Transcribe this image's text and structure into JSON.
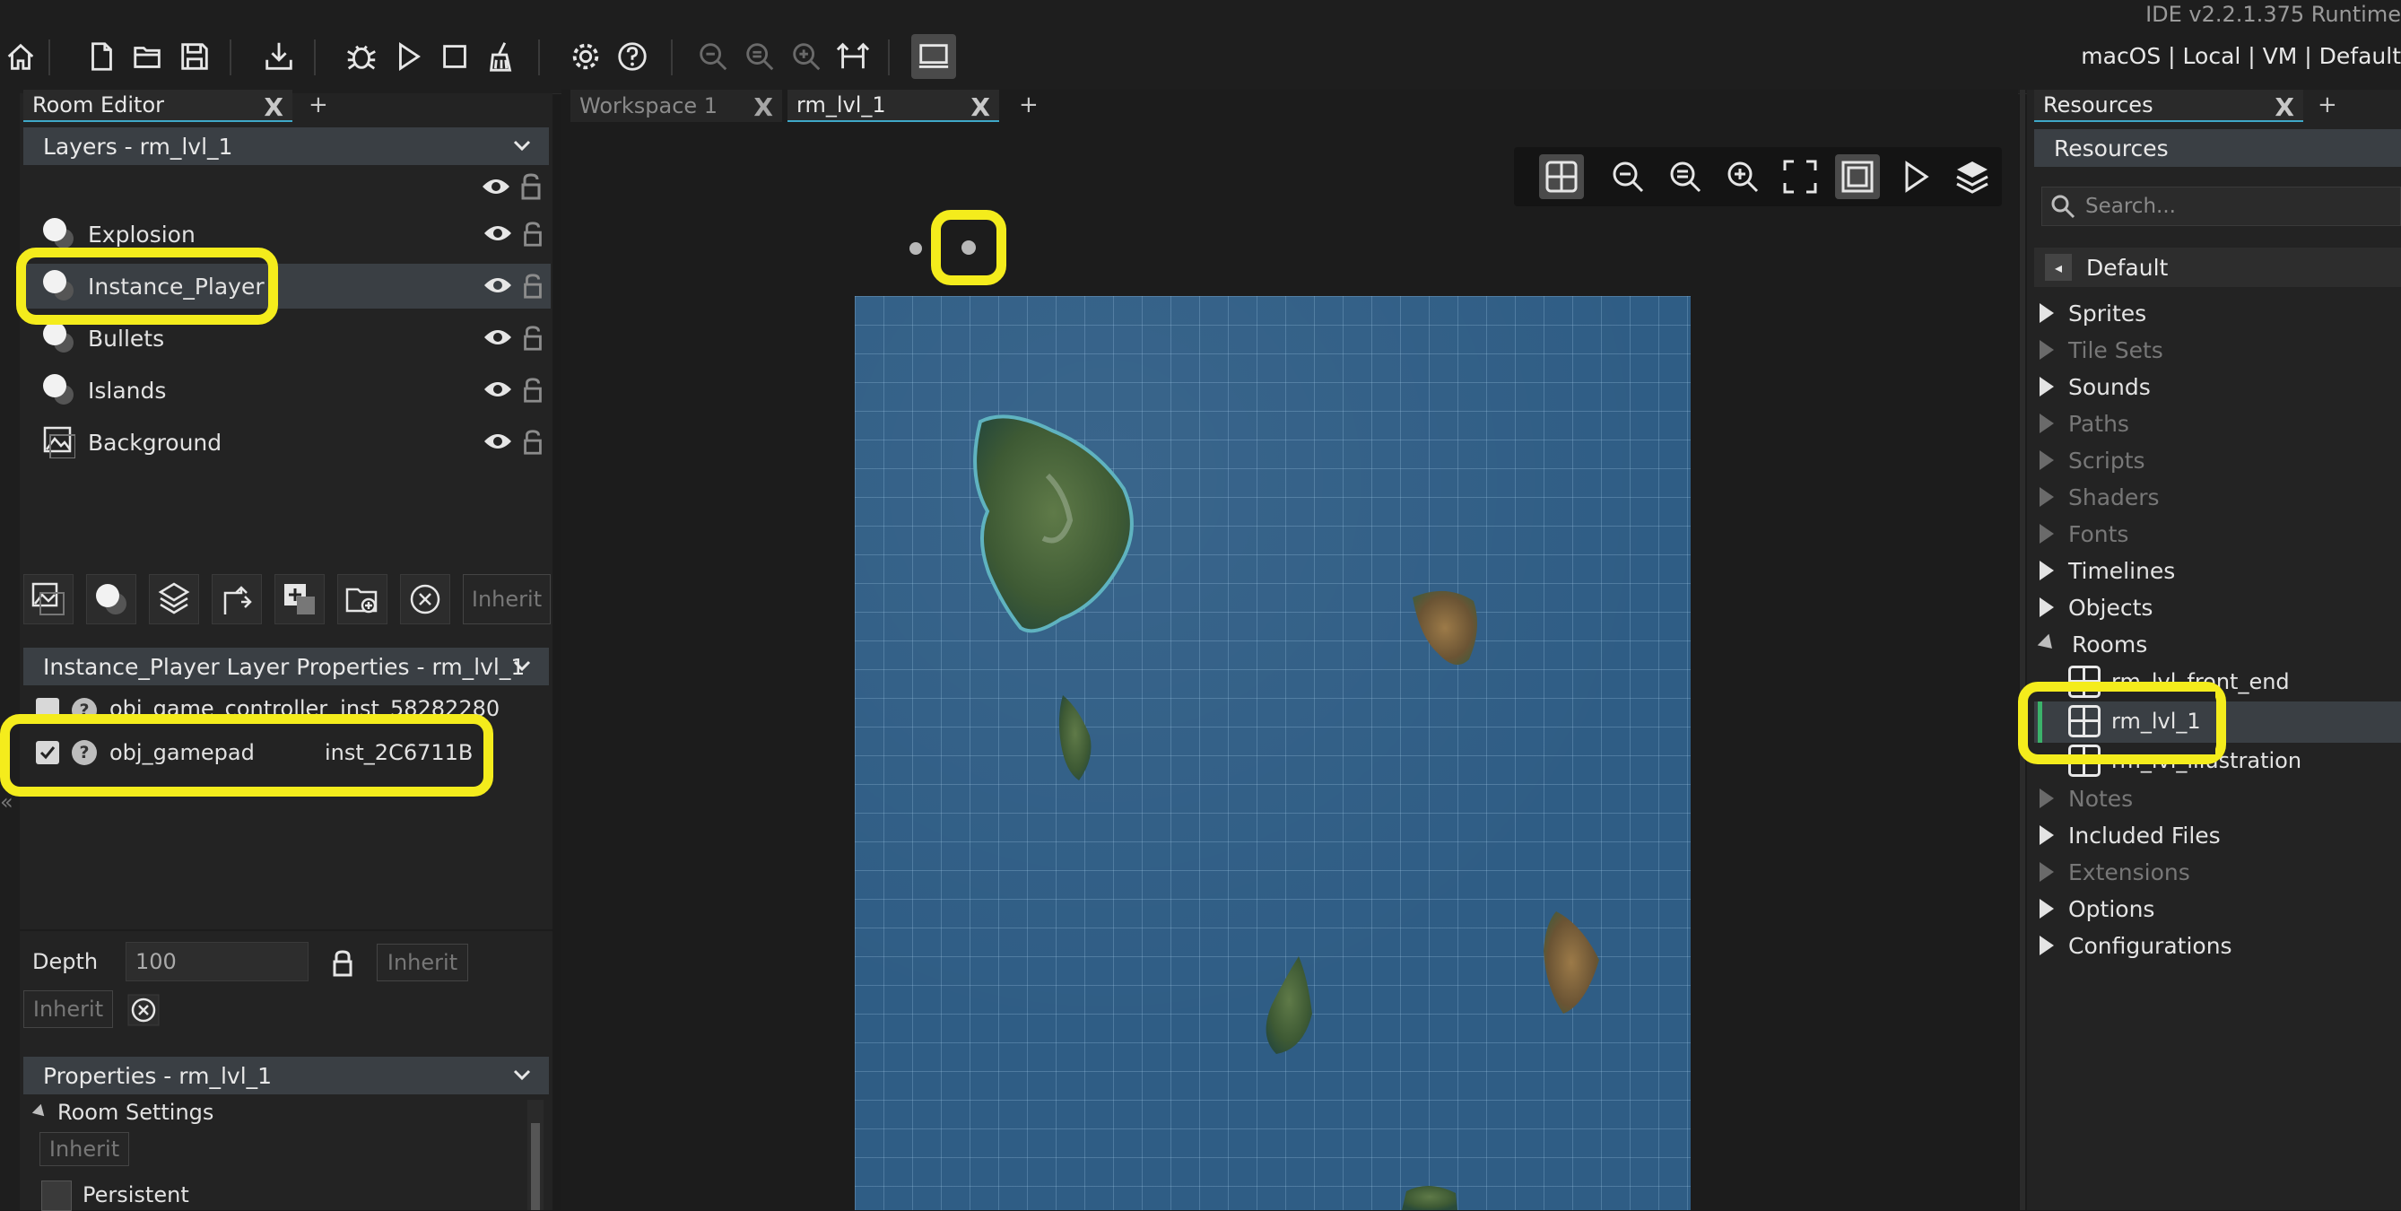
{
  "ide_version": "IDE v2.2.1.375  Runtime",
  "target": "macOS | Local | VM | Default",
  "toolbar": {
    "buttons": [
      "home-icon",
      "new-file-icon",
      "open-folder-icon",
      "save-icon",
      "create-executable-icon",
      "debug-icon",
      "run-icon",
      "stop-icon",
      "clean-icon",
      "settings-icon",
      "help-icon",
      "zoom-out-icon",
      "zoom-reset-icon",
      "zoom-in-icon",
      "layout-icon",
      "output-icon"
    ]
  },
  "room_editor": {
    "tab_label": "Room Editor",
    "layers_header": "Layers - rm_lvl_1",
    "layers": [
      {
        "name": "Explosion",
        "type": "instance"
      },
      {
        "name": "Instance_Player",
        "type": "instance",
        "selected": true
      },
      {
        "name": "Bullets",
        "type": "instance"
      },
      {
        "name": "Islands",
        "type": "instance"
      },
      {
        "name": "Background",
        "type": "background"
      }
    ],
    "layer_tools_inherit": "Inherit",
    "layer_props_header": "Instance_Player Layer Properties - rm_lvl_1",
    "instances": [
      {
        "object": "obj_game_controller",
        "id": "inst_58282280"
      },
      {
        "object": "obj_gamepad",
        "id": "inst_2C6711B"
      }
    ],
    "depth_label": "Depth",
    "depth_value": "100",
    "depth_inherit": "Inherit",
    "inherit2": "Inherit",
    "properties_header": "Properties - rm_lvl_1",
    "room_settings": "Room Settings",
    "room_inherit": "Inherit",
    "persistent": "Persistent"
  },
  "workspace": {
    "tabs": [
      "Workspace 1",
      "rm_lvl_1"
    ],
    "active_tab": "rm_lvl_1"
  },
  "resources": {
    "tab_label": "Resources",
    "title": "Resources",
    "search_placeholder": "Search...",
    "group": "Default",
    "items": [
      {
        "label": "Sprites",
        "enabled": true
      },
      {
        "label": "Tile Sets",
        "enabled": false
      },
      {
        "label": "Sounds",
        "enabled": true
      },
      {
        "label": "Paths",
        "enabled": false
      },
      {
        "label": "Scripts",
        "enabled": false
      },
      {
        "label": "Shaders",
        "enabled": false
      },
      {
        "label": "Fonts",
        "enabled": false
      },
      {
        "label": "Timelines",
        "enabled": true
      },
      {
        "label": "Objects",
        "enabled": true
      },
      {
        "label": "Rooms",
        "enabled": true,
        "expanded": true
      }
    ],
    "rooms": [
      "rm_lvl_front_end",
      "rm_lvl_1",
      "rm_lvl_illustration"
    ],
    "after_items": [
      {
        "label": "Notes",
        "enabled": false
      },
      {
        "label": "Included Files",
        "enabled": true
      },
      {
        "label": "Extensions",
        "enabled": false
      },
      {
        "label": "Options",
        "enabled": true
      },
      {
        "label": "Configurations",
        "enabled": true
      }
    ]
  },
  "colors": {
    "highlight": "#f4ec1c",
    "sea": "#2f5d85",
    "selected_row": "#3a3f44"
  }
}
